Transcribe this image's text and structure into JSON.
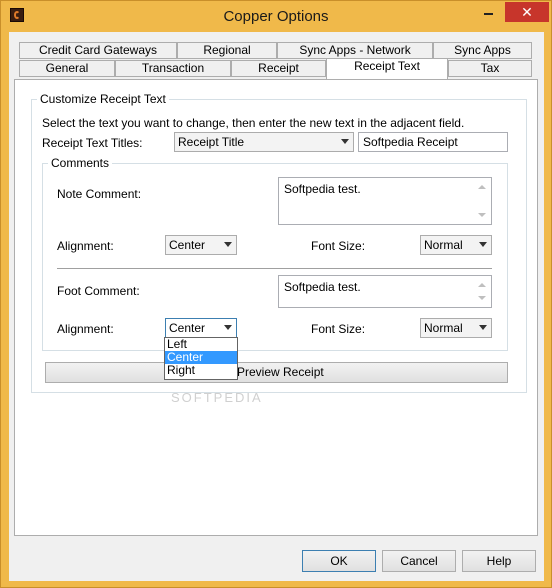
{
  "window": {
    "title": "Copper Options"
  },
  "tabs_row1": [
    "Credit Card Gateways",
    "Regional",
    "Sync Apps - Network",
    "Sync Apps"
  ],
  "tabs_row2": [
    "General",
    "Transaction",
    "Receipt",
    "Receipt Text",
    "Tax"
  ],
  "active_tab": "Receipt Text",
  "customize": {
    "group_title": "Customize Receipt Text",
    "instruction": "Select the text you want to change, then enter the new text in the adjacent field.",
    "titles_label": "Receipt Text Titles:",
    "titles_selected": "Receipt Title",
    "titles_value": "Softpedia Receipt"
  },
  "comments": {
    "group_title": "Comments",
    "note_label": "Note Comment:",
    "note_value": "Softpedia test.",
    "alignment_label": "Alignment:",
    "note_alignment": "Center",
    "font_size_label": "Font Size:",
    "note_font_size": "Normal",
    "foot_label": "Foot Comment:",
    "foot_value": "Softpedia test.",
    "foot_alignment": "Center",
    "foot_font_size": "Normal",
    "alignment_options": [
      "Left",
      "Center",
      "Right"
    ],
    "highlighted_option": "Center"
  },
  "preview_button": "Preview Receipt",
  "watermark": "SOFTPEDIA",
  "buttons": {
    "ok": "OK",
    "cancel": "Cancel",
    "help": "Help"
  },
  "colors": {
    "titlebar": "#f0b94a",
    "close": "#c7352b",
    "highlight": "#3399ff"
  }
}
